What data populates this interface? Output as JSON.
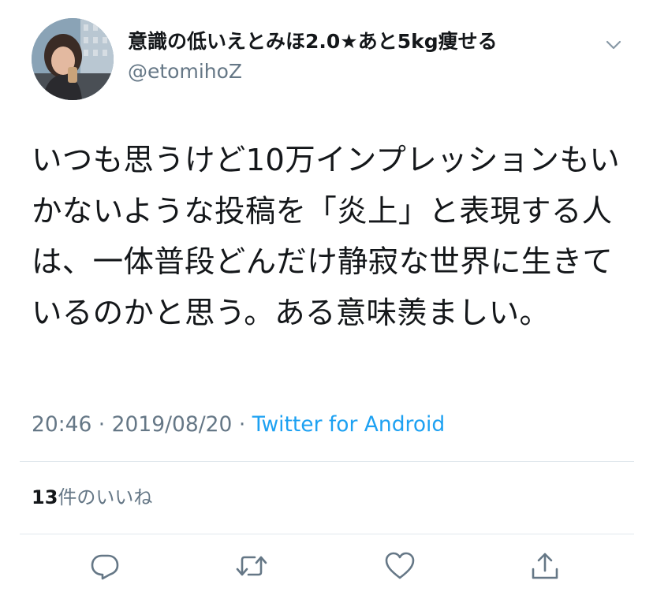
{
  "tweet": {
    "display_name": "意識の低いえとみほ2.0★あと5kg痩せる",
    "handle": "@etomihoZ",
    "text": "いつも思うけど10万インプレッションもいかないような投稿を「炎上」と表現する人は、一体普段どんだけ静寂な世界に生きているのかと思う。ある意味羨ましい。",
    "time": "20:46",
    "separator_1": " · ",
    "date": "2019/08/20",
    "separator_2": " · ",
    "source": "Twitter for Android",
    "likes_count": "13",
    "likes_label": "件のいいね"
  },
  "icons": {
    "menu": "chevron-down-icon",
    "reply": "reply-icon",
    "retweet": "retweet-icon",
    "like": "heart-icon",
    "share": "share-icon"
  },
  "colors": {
    "text": "#14171a",
    "secondary": "#657786",
    "link": "#1da1f2",
    "divider": "#e1e8ed"
  }
}
